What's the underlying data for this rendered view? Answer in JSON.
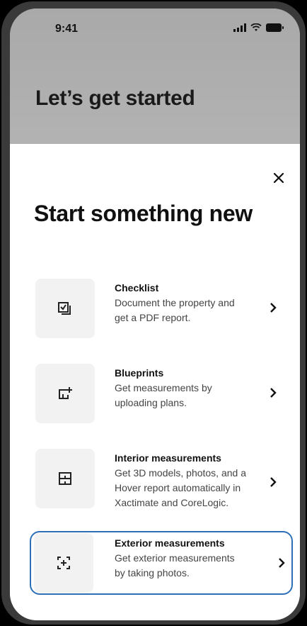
{
  "status": {
    "time": "9:41"
  },
  "background": {
    "title": "Let’s get started"
  },
  "sheet": {
    "title": "Start something new",
    "options": [
      {
        "title": "Checklist",
        "lines": [
          "Document the property and",
          "get a PDF report."
        ],
        "icon": "checklist-icon"
      },
      {
        "title": "Blueprints",
        "lines": [
          "Get measurements by",
          "uploading plans."
        ],
        "icon": "blueprint-icon"
      },
      {
        "title": "Interior measurements",
        "lines": [
          "Get 3D models, photos, and a",
          "Hover report automatically in",
          "Xactimate and CoreLogic."
        ],
        "icon": "interior-icon"
      },
      {
        "title": "Exterior measurements",
        "lines": [
          "Get exterior measurements",
          "by taking photos."
        ],
        "icon": "exterior-icon",
        "selected": true
      }
    ]
  },
  "colors": {
    "accent": "#2f6fb8",
    "icon_bg": "#f2f2f2"
  }
}
